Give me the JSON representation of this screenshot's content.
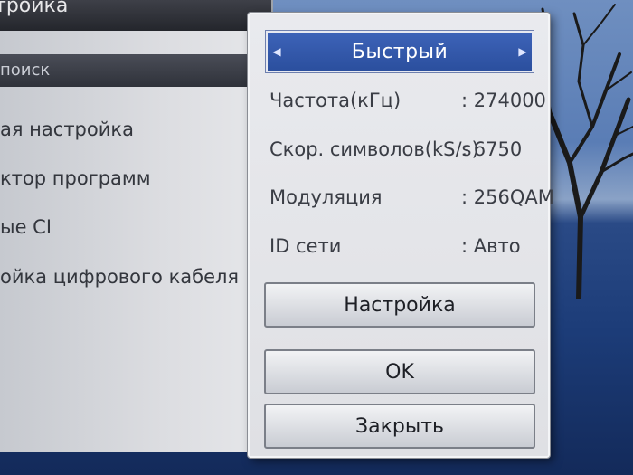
{
  "left_menu": {
    "header": "тройка",
    "items": [
      {
        "label": "поиск",
        "selected": true
      },
      {
        "label": "ая настройка",
        "selected": false
      },
      {
        "label": "ктор программ",
        "selected": false
      },
      {
        "label": "ые CI",
        "selected": false
      },
      {
        "label": "ойка цифрового кабеля",
        "selected": false
      }
    ]
  },
  "dialog": {
    "mode": {
      "value": "Быстрый",
      "left_arrow": "◀",
      "right_arrow": "▶"
    },
    "rows": [
      {
        "label": "Частота(кГц)",
        "value": ": 274000"
      },
      {
        "label": "Скор. символов(kS/s)",
        "value": ": 6750"
      },
      {
        "label": "Модуляция",
        "value": ": 256QAM"
      },
      {
        "label": "ID сети",
        "value": ": Авто"
      }
    ],
    "setup_button": "Настройка",
    "ok_button": "OK",
    "close_button": "Закрыть"
  },
  "colors": {
    "accent": "#2f55a6",
    "panel": "#e3e4e8"
  }
}
